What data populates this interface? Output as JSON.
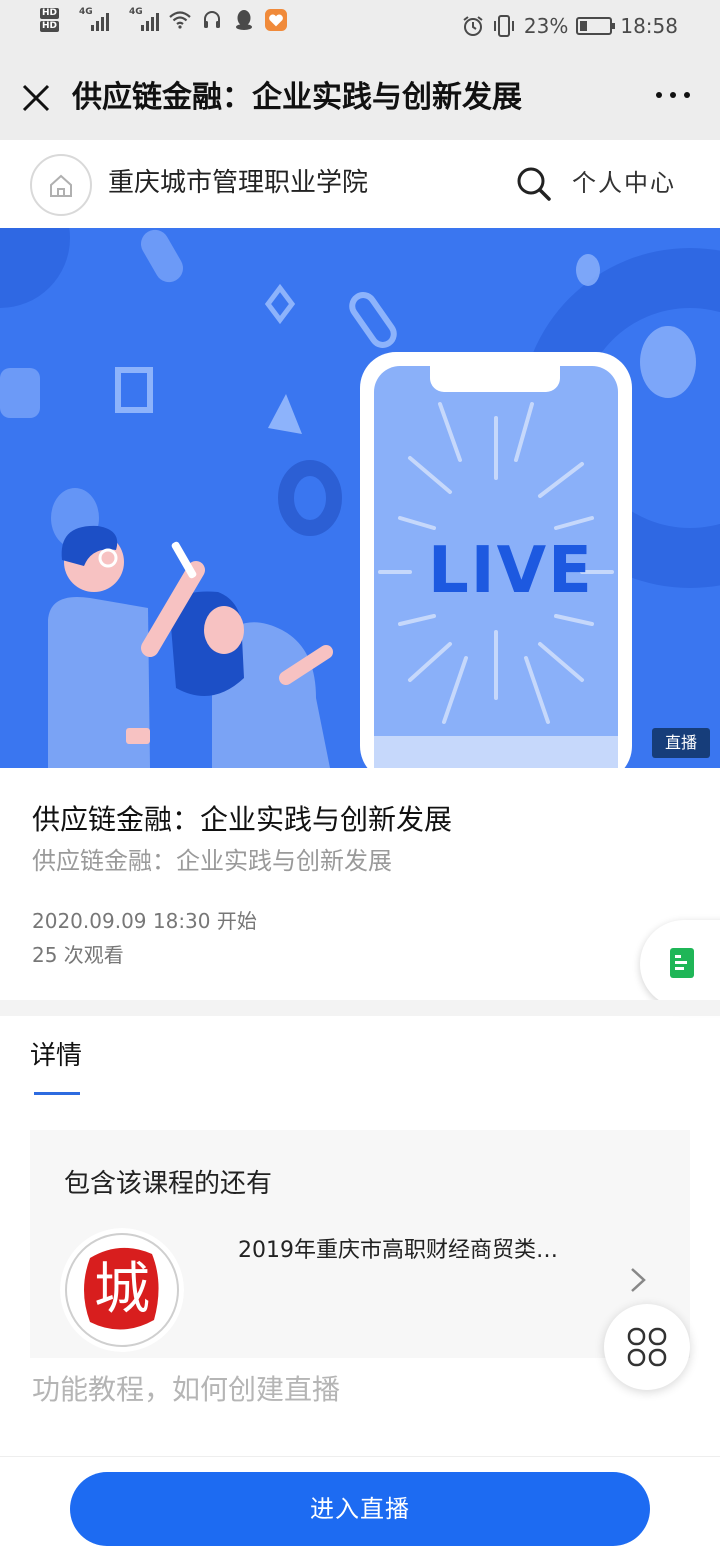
{
  "status_bar": {
    "hd1": "HD",
    "hd2": "HD",
    "net1": "4G",
    "net2": "4G",
    "battery_percent": "23%",
    "time": "18:58"
  },
  "title_bar": {
    "title": "供应链金融：企业实践与创新发展"
  },
  "site_header": {
    "school_name": "重庆城市管理职业学院",
    "profile_label": "个人中心"
  },
  "banner": {
    "live_text": "LIVE",
    "badge": "直播"
  },
  "course": {
    "title": "供应链金融：企业实践与创新发展",
    "subtitle": "供应链金融：企业实践与创新发展",
    "start_time": "2020.09.09 18:30 开始",
    "view_count": "25 次观看"
  },
  "details": {
    "tab_label": "详情",
    "related_heading": "包含该课程的还有",
    "related_items": [
      {
        "title": "2019年重庆市高职财经商贸类…",
        "logo_char": "城"
      }
    ],
    "tutorial_link": "功能教程，如何创建直播"
  },
  "actions": {
    "enter_live_label": "进入直播"
  },
  "colors": {
    "primary": "#1d6bf2",
    "banner_bg": "#3a76f0",
    "badge_bg": "#163d7a",
    "doc_green": "#1fb657",
    "logo_red": "#d81e1e"
  }
}
